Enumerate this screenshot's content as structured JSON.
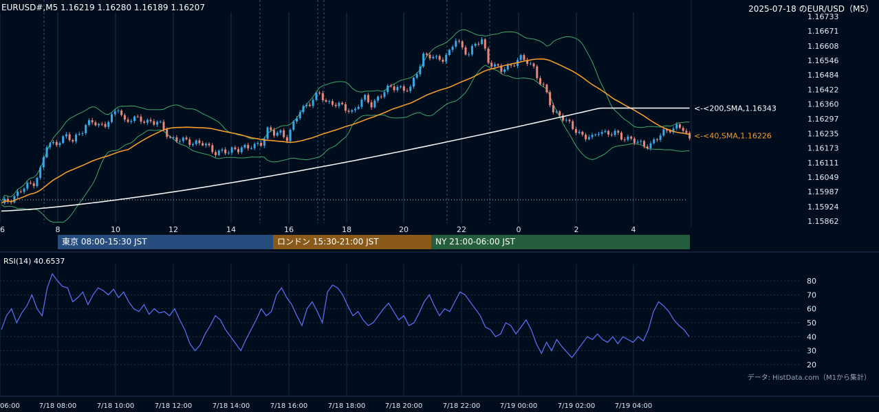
{
  "header": {
    "symbol_ohlc": "EURUSD#,M5 1.16219 1.16280 1.16189 1.16207",
    "title_right": "2025-07-18 のEUR/USD（M5）"
  },
  "sessions": [
    {
      "label": "東京 08:00-15:30 JST",
      "color": "#264d7d"
    },
    {
      "label": "ロンドン 15:30-21:00 JST",
      "color": "#8a5a1a"
    },
    {
      "label": "NY 21:00-06:00 JST",
      "color": "#245e3c"
    }
  ],
  "rsi_label": "RSI(14) 40.6537",
  "credit": "データ: HistData.com（M1から集計）",
  "colors": {
    "background": "#000d1d",
    "bull": "#3aa7e6",
    "bear": "#e8877a",
    "sma40": "#f59b2a",
    "sma200": "#f2f2f2",
    "bollinger": "#3fa86b",
    "rsi": "#5a6cf0"
  },
  "chart_data": [
    {
      "type": "candlestick",
      "title": "EURUSD#,M5 1.16219 1.16280 1.16189 1.16207",
      "x_tick_labels": [
        "6",
        "8",
        "10",
        "12",
        "14",
        "16",
        "18",
        "20",
        "22",
        "0",
        "2",
        "4"
      ],
      "y_tick_labels": [
        "1.16733",
        "1.16671",
        "1.16608",
        "1.16546",
        "1.16484",
        "1.16422",
        "1.16360",
        "1.16297",
        "1.16235",
        "1.16173",
        "1.16111",
        "1.16049",
        "1.15987",
        "1.15924",
        "1.15862"
      ],
      "ylim": [
        1.15862,
        1.16733
      ],
      "close_series": [
        [
          0,
          1.1593
        ],
        [
          5,
          1.1598
        ],
        [
          7,
          1.16
        ],
        [
          10,
          1.1603
        ],
        [
          12,
          1.1608
        ],
        [
          14,
          1.1618
        ],
        [
          16,
          1.1619
        ],
        [
          18,
          1.1621
        ],
        [
          20,
          1.1622
        ],
        [
          22,
          1.162
        ],
        [
          24,
          1.1624
        ],
        [
          26,
          1.1627
        ],
        [
          28,
          1.1628
        ],
        [
          30,
          1.1627
        ],
        [
          32,
          1.1628
        ],
        [
          34,
          1.163
        ],
        [
          36,
          1.1634
        ],
        [
          38,
          1.1629
        ],
        [
          40,
          1.163
        ],
        [
          42,
          1.1629
        ],
        [
          44,
          1.1629
        ],
        [
          46,
          1.1629
        ],
        [
          48,
          1.1628
        ],
        [
          50,
          1.1625
        ],
        [
          52,
          1.1622
        ],
        [
          54,
          1.1621
        ],
        [
          56,
          1.162
        ],
        [
          58,
          1.162
        ],
        [
          60,
          1.162
        ],
        [
          62,
          1.1619
        ],
        [
          64,
          1.1617
        ],
        [
          66,
          1.1616
        ],
        [
          68,
          1.1616
        ],
        [
          70,
          1.1615
        ],
        [
          72,
          1.1617
        ],
        [
          74,
          1.1618
        ],
        [
          76,
          1.1617
        ],
        [
          78,
          1.1618
        ],
        [
          80,
          1.162
        ],
        [
          82,
          1.1625
        ],
        [
          84,
          1.1623
        ],
        [
          86,
          1.1624
        ],
        [
          88,
          1.1622
        ],
        [
          90,
          1.1627
        ],
        [
          92,
          1.1633
        ],
        [
          94,
          1.1636
        ],
        [
          96,
          1.1638
        ],
        [
          98,
          1.164
        ],
        [
          100,
          1.1637
        ],
        [
          102,
          1.1637
        ],
        [
          104,
          1.1635
        ],
        [
          106,
          1.1634
        ],
        [
          108,
          1.1633
        ],
        [
          110,
          1.1636
        ],
        [
          112,
          1.1638
        ],
        [
          114,
          1.1636
        ],
        [
          116,
          1.1639
        ],
        [
          118,
          1.1641
        ],
        [
          120,
          1.1643
        ],
        [
          122,
          1.1644
        ],
        [
          124,
          1.1642
        ],
        [
          126,
          1.1642
        ],
        [
          128,
          1.165
        ],
        [
          130,
          1.1657
        ],
        [
          132,
          1.1656
        ],
        [
          134,
          1.1655
        ],
        [
          136,
          1.1656
        ],
        [
          138,
          1.1658
        ],
        [
          140,
          1.1663
        ],
        [
          142,
          1.166
        ],
        [
          144,
          1.1658
        ],
        [
          146,
          1.1661
        ],
        [
          148,
          1.1663
        ],
        [
          150,
          1.1655
        ],
        [
          152,
          1.1652
        ],
        [
          154,
          1.165
        ],
        [
          156,
          1.1652
        ],
        [
          158,
          1.1654
        ],
        [
          160,
          1.1655
        ],
        [
          162,
          1.1654
        ],
        [
          164,
          1.1652
        ],
        [
          166,
          1.1645
        ],
        [
          168,
          1.164
        ],
        [
          170,
          1.1633
        ],
        [
          172,
          1.1632
        ],
        [
          174,
          1.1628
        ],
        [
          176,
          1.1626
        ],
        [
          178,
          1.1624
        ],
        [
          180,
          1.1622
        ],
        [
          182,
          1.1621
        ],
        [
          184,
          1.1625
        ],
        [
          186,
          1.1624
        ],
        [
          188,
          1.1623
        ],
        [
          190,
          1.1623
        ],
        [
          192,
          1.1622
        ],
        [
          194,
          1.1621
        ],
        [
          196,
          1.1619
        ],
        [
          198,
          1.1619
        ],
        [
          200,
          1.1619
        ],
        [
          202,
          1.1621
        ],
        [
          204,
          1.1624
        ],
        [
          206,
          1.1626
        ],
        [
          208,
          1.1626
        ],
        [
          210,
          1.1625
        ],
        [
          212,
          1.1621
        ]
      ],
      "sma200_last": 1.16343,
      "sma40_last": 1.16226,
      "annotations": [
        "<-<200,SMA,1.16343",
        "<-<40,SMA,1.16226"
      ]
    },
    {
      "type": "line",
      "title": "RSI(14) 40.6537",
      "y_tick_labels": [
        "80",
        "70",
        "60",
        "50",
        "40",
        "30",
        "20"
      ],
      "ylim": [
        20,
        80
      ],
      "x_tick_labels": [
        "06:00",
        "7/18 08:00",
        "7/18 10:00",
        "7/18 12:00",
        "7/18 14:00",
        "7/18 16:00",
        "7/18 18:00",
        "7/18 20:00",
        "7/18 22:00",
        "7/19 00:00",
        "7/19 02:00",
        "7/19 04:00"
      ],
      "series": [
        {
          "values": [
            45,
            55,
            60,
            50,
            57,
            62,
            70,
            60,
            55,
            75,
            85,
            80,
            76,
            75,
            65,
            68,
            72,
            63,
            70,
            75,
            73,
            70,
            74,
            68,
            72,
            65,
            60,
            58,
            63,
            56,
            60,
            57,
            58,
            55,
            60,
            52,
            45,
            35,
            30,
            34,
            42,
            48,
            55,
            52,
            45,
            40,
            35,
            30,
            38,
            45,
            52,
            60,
            55,
            58,
            70,
            75,
            68,
            63,
            55,
            48,
            60,
            65,
            58,
            50,
            72,
            77,
            75,
            70,
            62,
            55,
            58,
            52,
            48,
            50,
            55,
            60,
            64,
            58,
            52,
            55,
            48,
            50,
            57,
            65,
            70,
            62,
            55,
            60,
            58,
            65,
            72,
            70,
            65,
            60,
            55,
            47,
            45,
            40,
            42,
            50,
            48,
            42,
            47,
            52,
            45,
            35,
            28,
            36,
            30,
            38,
            33,
            29,
            25,
            30,
            35,
            40,
            38,
            42,
            38,
            36,
            40,
            35,
            40,
            38,
            36,
            40,
            37,
            45,
            58,
            65,
            62,
            58,
            52,
            48,
            45,
            40
          ]
        }
      ]
    }
  ]
}
